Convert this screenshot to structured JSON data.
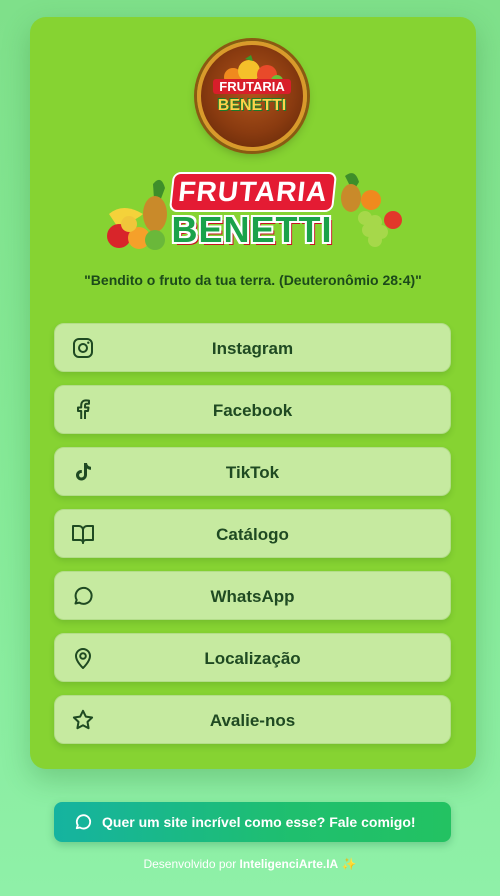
{
  "logo": {
    "line1": "FRUTARIA",
    "line2": "BENETTI"
  },
  "banner": {
    "line1": "FRUTARIA",
    "line2": "BENETTI"
  },
  "quote": "\"Bendito o fruto da tua terra. (Deuteronômio 28:4)\"",
  "links": [
    {
      "label": "Instagram",
      "icon": "instagram-icon"
    },
    {
      "label": "Facebook",
      "icon": "facebook-icon"
    },
    {
      "label": "TikTok",
      "icon": "tiktok-icon"
    },
    {
      "label": "Catálogo",
      "icon": "book-icon"
    },
    {
      "label": "WhatsApp",
      "icon": "chat-icon"
    },
    {
      "label": "Localização",
      "icon": "map-pin-icon"
    },
    {
      "label": "Avalie-nos",
      "icon": "star-icon"
    }
  ],
  "cta": {
    "label": "Quer um site incrível como esse? Fale comigo!",
    "icon": "chat-icon"
  },
  "footer": {
    "prefix": "Desenvolvido por ",
    "brand": "InteligenciArte.IA",
    "sparkle": "✨"
  },
  "colors": {
    "background": "#86ea98",
    "card": "#86d332",
    "button": "#c6eaa0",
    "text": "#1f4a22",
    "cta_start": "#15b3a0",
    "cta_end": "#23c262"
  }
}
